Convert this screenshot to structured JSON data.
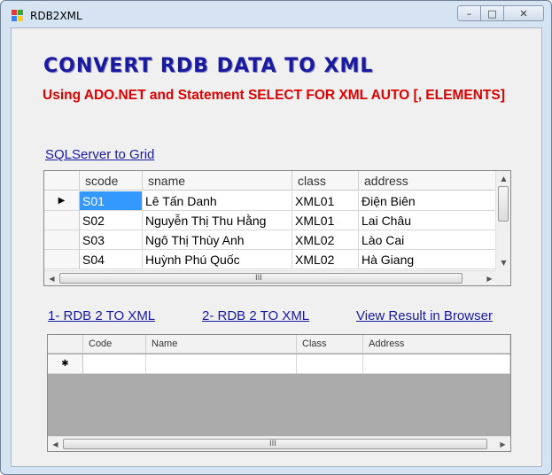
{
  "window": {
    "title": "RDB2XML",
    "minimize": "–",
    "maximize": "□",
    "close": "✕"
  },
  "heading": "CONVERT RDB DATA TO XML",
  "subheading": "Using ADO.NET and Statement SELECT FOR XML AUTO [, ELEMENTS]",
  "links": {
    "sqlserver_to_grid": "SQLServer to Grid",
    "rdb2xml_1": "1- RDB 2 TO XML",
    "rdb2xml_2": "2- RDB 2 TO XML",
    "view_result": "View Result in Browser"
  },
  "grid1": {
    "columns": [
      "scode",
      "sname",
      "class",
      "address"
    ],
    "rows": [
      [
        "S01",
        "Lê Tấn Danh",
        "XML01",
        "Điện Biên"
      ],
      [
        "S02",
        "Nguyễn Thị Thu Hằng",
        "XML01",
        "Lai Châu"
      ],
      [
        "S03",
        "Ngô Thị Thùy Anh",
        "XML02",
        "Lào Cai"
      ],
      [
        "S04",
        "Huỳnh Phú Quốc",
        "XML02",
        "Hà Giang"
      ]
    ],
    "current_row_marker": "▶"
  },
  "grid2": {
    "columns": [
      "Code",
      "Name",
      "Class",
      "Address"
    ],
    "new_row_marker": "✱"
  },
  "scroll": {
    "up": "▲",
    "down": "▼",
    "left": "◀",
    "right": "▶",
    "grip": "III"
  },
  "colors": {
    "heading": "#1a1aa0",
    "subheading": "#e00000",
    "selection": "#3399ff"
  }
}
